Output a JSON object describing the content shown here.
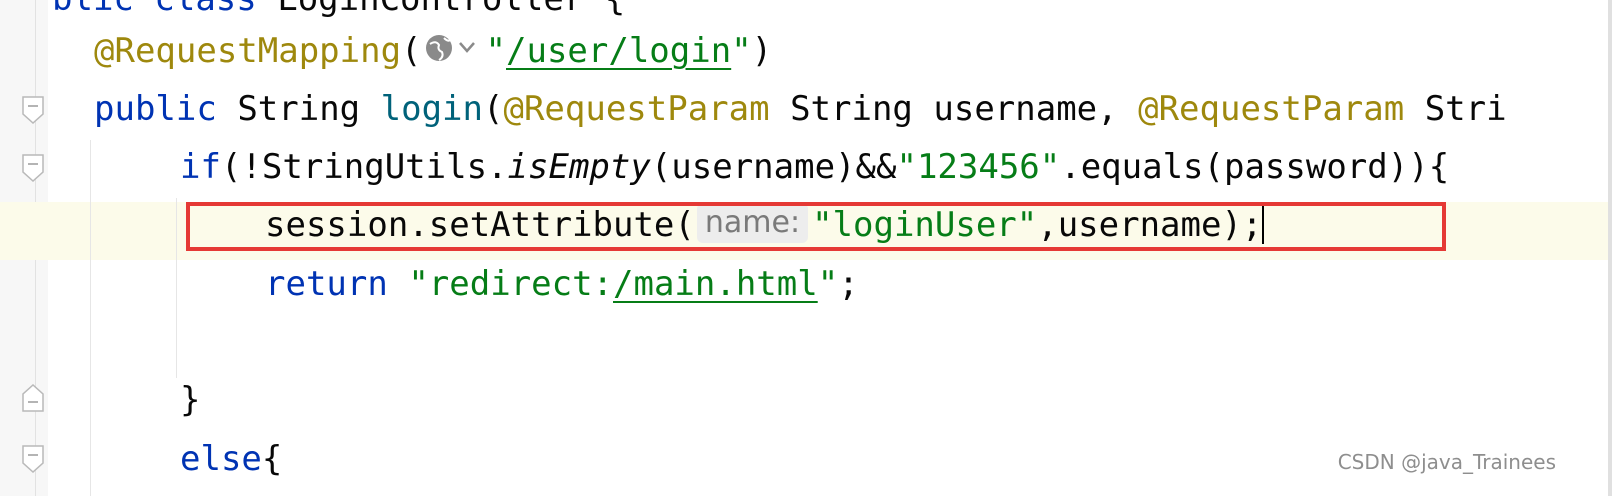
{
  "editor": {
    "lines": {
      "l0": {
        "kw1": "blic",
        "kw2": "class",
        "name": "LoginController",
        "brace": "{"
      },
      "l1": {
        "annotation": "@RequestMapping",
        "open": "(",
        "q1": "\"",
        "url": "/user/login",
        "q2": "\"",
        "close": ")"
      },
      "l2": {
        "kw": "public",
        "type1": "String",
        "method": "login",
        "open": "(",
        "ann1": "@RequestParam",
        "type2": "String",
        "param1": "username,",
        "ann2": "@RequestParam",
        "type3": "Stri"
      },
      "l3": {
        "kw": "if",
        "p1": "(!StringUtils.",
        "method": "isEmpty",
        "p2": "(username)&&",
        "str": "\"123456\"",
        "p3": ".equals(password)){"
      },
      "l4": {
        "p1": "session.setAttribute(",
        "hint": "name:",
        "str": "\"loginUser\"",
        "p2": ",username);"
      },
      "l5": {
        "kw": "return",
        "q1": "\"redirect:",
        "url": "/main.html",
        "q2": "\"",
        "end": ";"
      },
      "l7": {
        "brace": "}"
      },
      "l8": {
        "kw": "else",
        "brace": "{"
      }
    }
  },
  "watermark": "CSDN @java_Trainees",
  "colors": {
    "keyword": "#0033b3",
    "annotation": "#9e880d",
    "string": "#067d17",
    "method": "#00627a",
    "highlight_border": "#e53935"
  }
}
